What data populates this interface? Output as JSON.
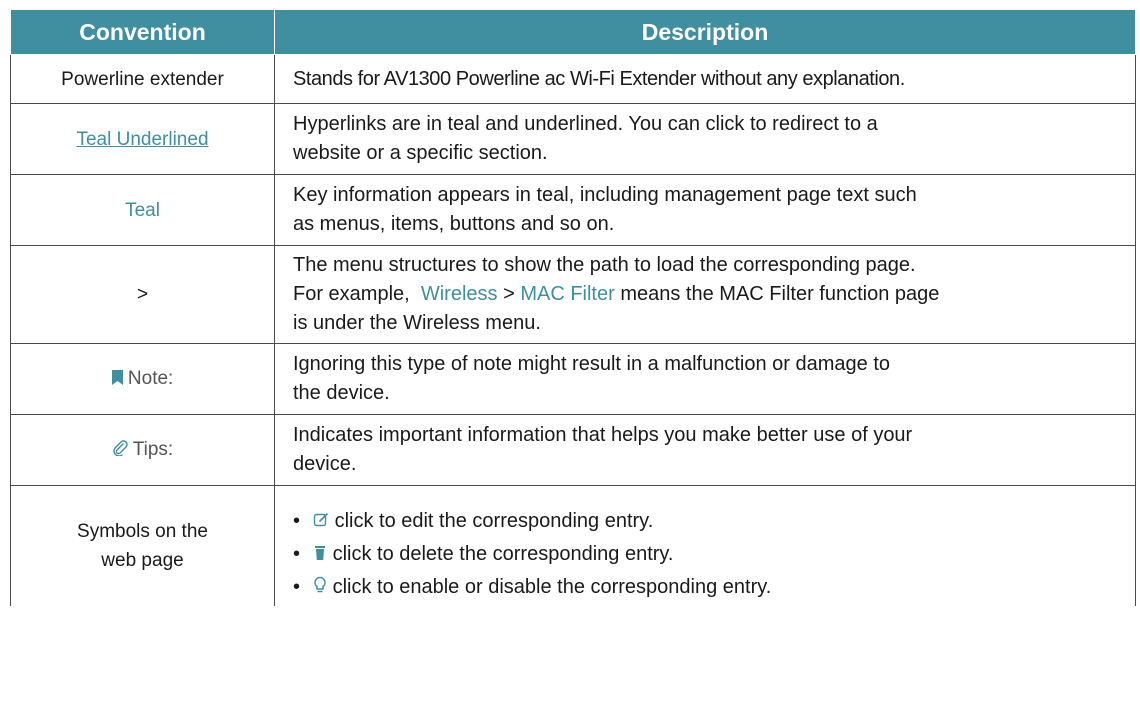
{
  "header": {
    "convention": "Convention",
    "description": "Description"
  },
  "rows": {
    "powerline": {
      "convention": "Powerline extender",
      "description": "Stands for AV1300 Powerline ac Wi-Fi Extender without any explanation."
    },
    "teal_underlined": {
      "convention": "Teal Underlined",
      "description_line1": "Hyperlinks are in teal and underlined. You can click to redirect to a",
      "description_line2": "website or a specific section."
    },
    "teal": {
      "convention": "Teal",
      "description_line1": "Key information appears in teal, including management page text such",
      "description_line2": "as menus, items, buttons and so on."
    },
    "menu_path": {
      "convention": ">",
      "description_line1": "The menu structures to show the path to load the corresponding page.",
      "example_prefix": "For example,",
      "example_menu": "Wireless",
      "example_sep": ">",
      "example_item": "MAC Filter",
      "example_suffix": "means the MAC Filter function page",
      "description_line3": "is under the Wireless menu."
    },
    "note": {
      "convention": "Note:",
      "icon": "bookmark-icon",
      "description_line1": "Ignoring this type of note might result in a malfunction or damage to",
      "description_line2": "the device."
    },
    "tips": {
      "convention": "Tips:",
      "icon": "paperclip-icon",
      "description_line1": "Indicates important information that helps you make better use of your",
      "description_line2": "device."
    },
    "symbols": {
      "convention_line1": "Symbols on the",
      "convention_line2": "web page",
      "items": [
        {
          "icon": "edit-icon",
          "text": "click to edit the corresponding entry."
        },
        {
          "icon": "trash-icon",
          "text": "click to delete the corresponding entry."
        },
        {
          "icon": "lightbulb-icon",
          "text": "click to enable or disable the corresponding entry."
        }
      ]
    }
  },
  "colors": {
    "accent": "#3f8fa0",
    "header_text": "#ffffff",
    "grid": "#4a4a4a"
  }
}
